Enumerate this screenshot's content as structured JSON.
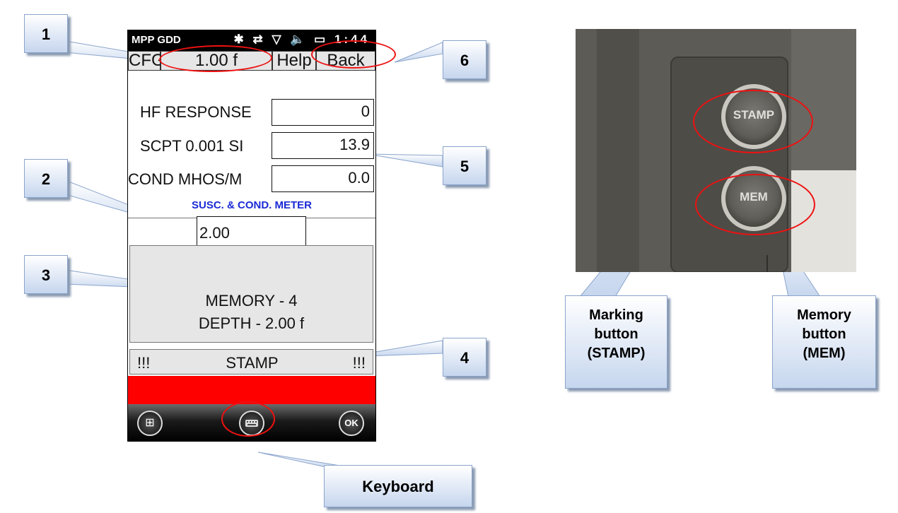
{
  "status_bar": {
    "app_name": "MPP GDD",
    "clock": "1:44",
    "icons": "✱ ⇄ ▽ 🔈 ▭"
  },
  "toolbar": {
    "cfg_label": "CFG",
    "depth_label": "1.00 f",
    "help_label": "Help",
    "back_label": "Back"
  },
  "readings": [
    {
      "label": "HF  RESPONSE",
      "value": "0"
    },
    {
      "label": "SCPT  0.001 SI",
      "value": "13.9"
    },
    {
      "label": "COND MHOS/M",
      "value": "0.0"
    }
  ],
  "meter_title": "SUSC. & COND.  METER",
  "depth_input": {
    "value": "2.00"
  },
  "memory_panel": {
    "line1": "MEMORY - 4",
    "line2": "DEPTH - 2.00 f"
  },
  "stamp_bar": {
    "left_marks": "!!!",
    "label": "STAMP",
    "right_marks": "!!!"
  },
  "taskbar": {
    "ok_label": "OK"
  },
  "callouts": {
    "c1": "1",
    "c2": "2",
    "c3": "3",
    "c4": "4",
    "c5": "5",
    "c6": "6",
    "keyboard": "Keyboard"
  },
  "photo": {
    "stamp_button_text": "STAMP",
    "mem_button_text": "MEM",
    "marking_callout": "Marking\nbutton\n(STAMP)",
    "memory_callout": "Memory\nbutton\n(MEM)"
  },
  "colors": {
    "red_bar": "#ff0000",
    "meter_title": "#1a2ad6",
    "annotation_ring": "#ee1111"
  }
}
